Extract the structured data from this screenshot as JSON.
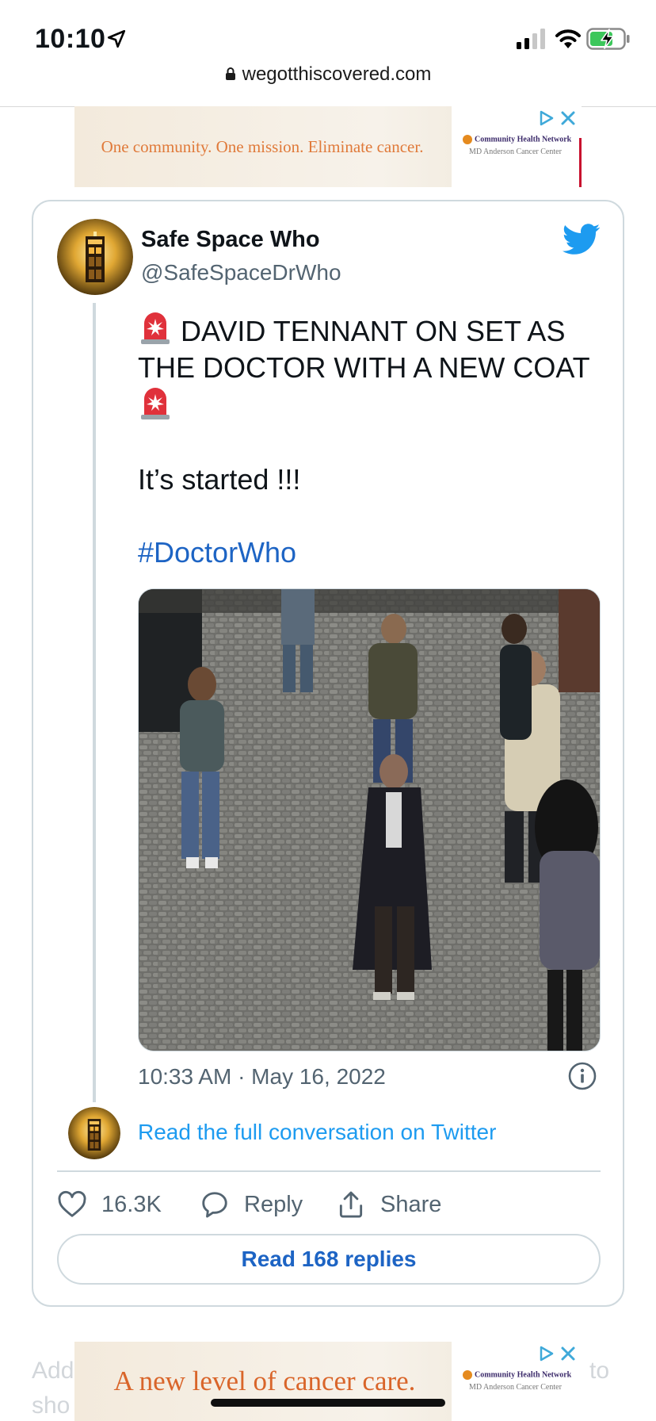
{
  "status_bar": {
    "time": "10:10",
    "icons": [
      "location-arrow-icon",
      "signal-icon",
      "wifi-icon",
      "battery-charging-icon"
    ]
  },
  "browser": {
    "url": "wegotthiscovered.com"
  },
  "ads": {
    "top": {
      "text": "One community. One mission. Eliminate cancer.",
      "logo_line1": "Community Health Network",
      "logo_line2": "MD Anderson Cancer Center"
    },
    "bottom": {
      "text": "A new level of cancer care.",
      "logo_line1": "Community Health Network",
      "logo_line2": "MD Anderson Cancer Center"
    }
  },
  "tweet": {
    "author_name": "Safe Space Who",
    "author_handle": "@SafeSpaceDrWho",
    "text_line1": "DAVID TENNANT ON SET AS",
    "text_line2": "THE DOCTOR WITH A NEW COAT",
    "text_line3": "It’s started !!!",
    "hashtag": "#DoctorWho",
    "timestamp": "10:33 AM · May 16, 2022",
    "read_full_conversation": "Read the full conversation on Twitter",
    "likes": "16.3K",
    "reply_label": "Reply",
    "share_label": "Share",
    "read_replies_label": "Read 168 replies"
  },
  "behind_text": {
    "left_top": "Add",
    "left_bottom": "sho",
    "right_top": "to"
  },
  "colors": {
    "link_blue": "#1d9bf0",
    "hashtag_blue": "#1d64c4",
    "muted_gray": "#536471",
    "border_gray": "#cfd9de",
    "ad_orange": "#e07a3a"
  }
}
